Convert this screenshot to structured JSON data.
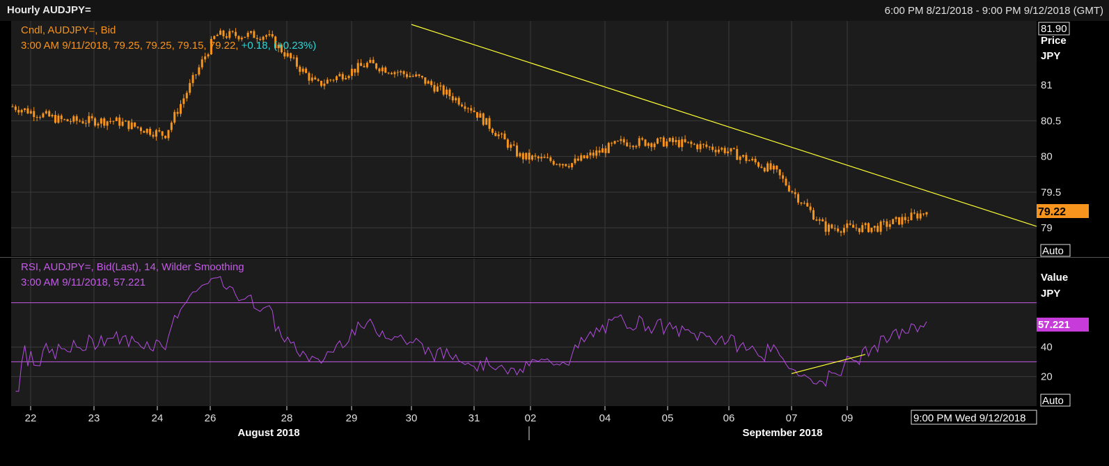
{
  "header": {
    "title": "Hourly AUDJPY=",
    "date_range": "6:00 PM 8/21/2018 - 9:00 PM 9/12/2018 (GMT)"
  },
  "colors": {
    "background": "#000000",
    "panel": "#1c1c1c",
    "grid": "#3a3a3a",
    "candle": "#f7941d",
    "trendline": "#ffff33",
    "rsi": "#b44de0",
    "rsi_levels": "#c45be8",
    "change_text": "#2fd5d5",
    "axis_text": "#e0e0e0"
  },
  "price_panel": {
    "legend_line1": "Cndl, AUDJPY=, Bid",
    "legend_line2_prefix": "3:00 AM 9/11/2018, 79.25, 79.25, 79.15, 79.22,",
    "legend_line2_change": " +0.18, (+0.23%)",
    "axis_top_value": "81.90",
    "axis_title_1": "Price",
    "axis_title_2": "JPY",
    "auto_label": "Auto",
    "last_price": "79.22"
  },
  "rsi_panel": {
    "legend_line1": "RSI, AUDJPY=, Bid(Last),  14, Wilder Smoothing",
    "legend_line2": "3:00 AM 9/11/2018, 57.221",
    "axis_title_1": "Value",
    "axis_title_2": "JPY",
    "auto_label": "Auto",
    "last_value": "57.221"
  },
  "x_axis": {
    "ticks": [
      "22",
      "23",
      "24",
      "26",
      "28",
      "29",
      "30",
      "31",
      "02",
      "04",
      "05",
      "06",
      "07",
      "09"
    ],
    "month_labels": [
      "August 2018",
      "September 2018"
    ],
    "cursor_label": "9:00 PM Wed 9/12/2018"
  },
  "chart_data": [
    {
      "type": "candlestick",
      "title": "Cndl, AUDJPY=, Bid",
      "ylabel": "Price JPY",
      "ylim": [
        78.6,
        81.9
      ],
      "yticks": [
        79,
        79.5,
        80,
        80.5,
        81
      ],
      "grid": true,
      "x": [
        "8/21 18:00",
        "8/22",
        "8/23",
        "8/24",
        "8/26",
        "8/28",
        "8/29",
        "8/30",
        "8/31",
        "9/02",
        "9/04",
        "9/05",
        "9/06",
        "9/07",
        "9/09",
        "9/11 03:00",
        "9/11 12:00"
      ],
      "close_path": [
        80.7,
        80.5,
        80.5,
        80.3,
        81.7,
        81.7,
        81.0,
        81.3,
        81.1,
        80.7,
        80.0,
        79.9,
        80.2,
        80.2,
        80.1,
        79.8,
        79.0,
        79.0,
        79.22
      ],
      "last_ohlc": {
        "time": "3:00 AM 9/11/2018",
        "open": 79.25,
        "high": 79.25,
        "low": 79.15,
        "close": 79.22,
        "change": 0.18,
        "change_pct": 0.23
      },
      "trendline": {
        "from": {
          "x": "8/30",
          "y": 81.85
        },
        "to": {
          "x": "9/12",
          "y": 79.02
        }
      }
    },
    {
      "type": "line",
      "title": "RSI, AUDJPY=, Bid(Last),  14, Wilder Smoothing",
      "ylabel": "Value JPY",
      "ylim": [
        0,
        100
      ],
      "yticks": [
        20,
        40
      ],
      "reference_levels": [
        30,
        70
      ],
      "series": [
        {
          "name": "RSI",
          "last_value": 57.221
        }
      ],
      "trendline": {
        "from": {
          "x": "9/07",
          "y": 22
        },
        "to": {
          "x": "9/09",
          "y": 35
        }
      }
    }
  ]
}
